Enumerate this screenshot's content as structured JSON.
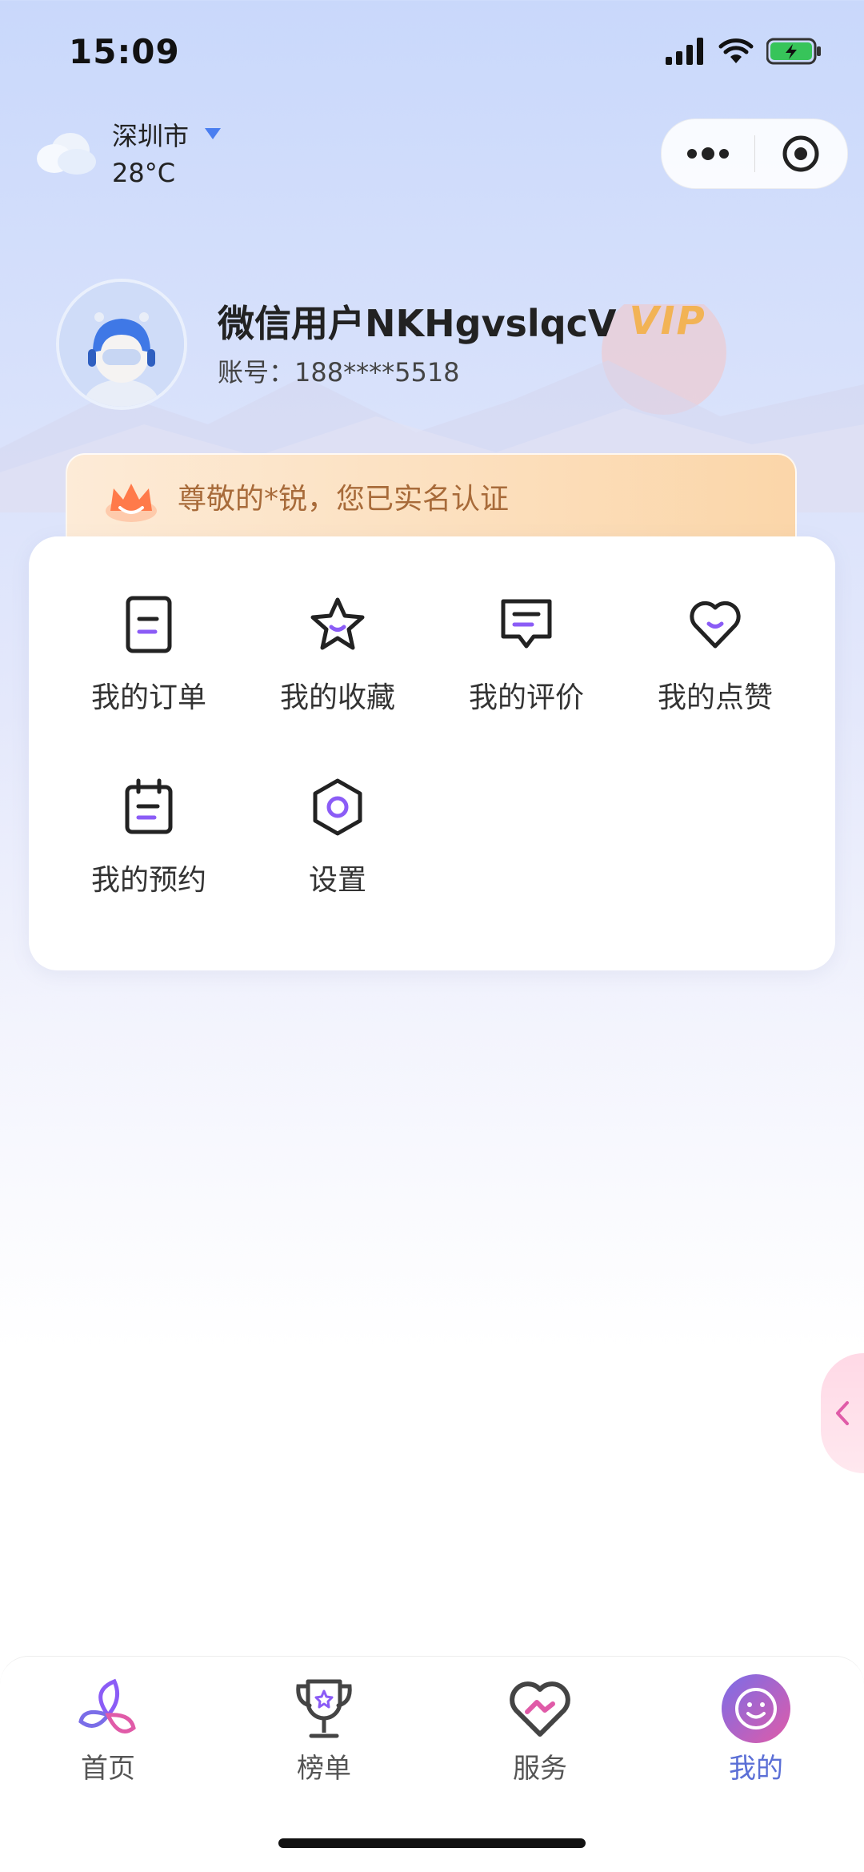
{
  "status_bar": {
    "time": "15:09"
  },
  "location": {
    "city": "深圳市",
    "temperature": "28°C"
  },
  "profile": {
    "username": "微信用户NKHgvslqcV",
    "vip_badge": "VIP",
    "account_label": "账号：",
    "account_number": "188****5518"
  },
  "verification": {
    "text": "尊敬的*锐，您已实名认证"
  },
  "menu": {
    "orders": "我的订单",
    "favorites": "我的收藏",
    "reviews": "我的评价",
    "likes": "我的点赞",
    "appointments": "我的预约",
    "settings": "设置"
  },
  "tabbar": {
    "home": "首页",
    "ranking": "榜单",
    "service": "服务",
    "mine": "我的",
    "active": "mine"
  },
  "colors": {
    "accent_purple": "#8b5cf6",
    "accent_pink": "#e05ba8",
    "vip_gold": "#f2b355",
    "active_tab": "#5b6fd6"
  },
  "icons": {
    "weather": "cloud-icon",
    "location_dropdown": "caret-down-icon",
    "capsule_more": "more-dots-icon",
    "capsule_close": "target-circle-icon",
    "banner": "crown-icon",
    "side_tab": "chevron-left-icon"
  }
}
